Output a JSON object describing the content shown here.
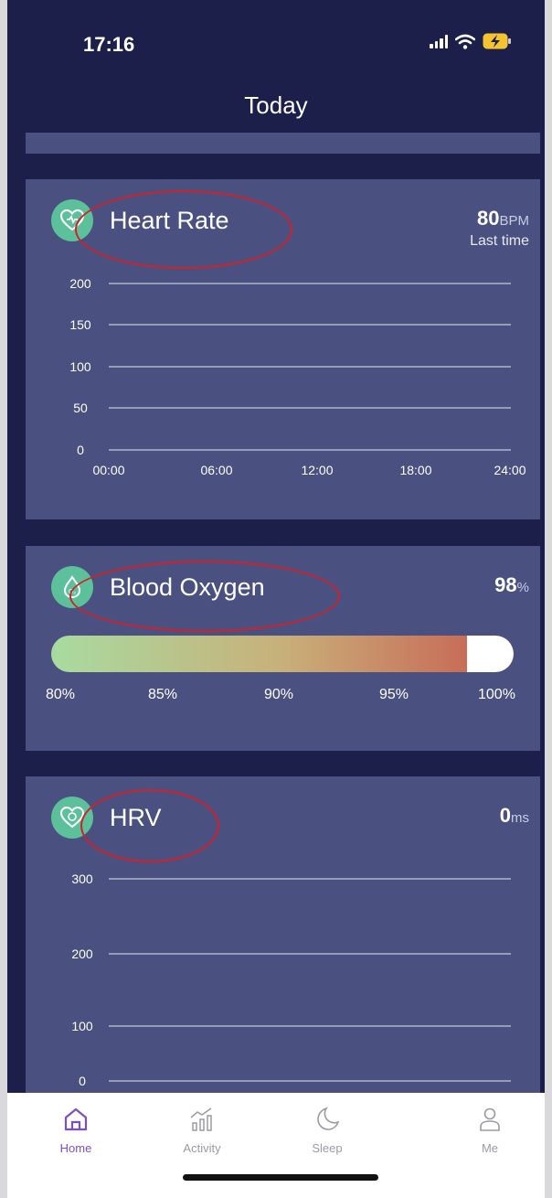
{
  "status": {
    "time": "17:16"
  },
  "header": {
    "title": "Today"
  },
  "heart_rate": {
    "title": "Heart Rate",
    "value": "80",
    "unit": "BPM",
    "sub": "Last time",
    "y_ticks": [
      "200",
      "150",
      "100",
      "50",
      "0"
    ],
    "x_ticks": [
      "00:00",
      "06:00",
      "12:00",
      "18:00",
      "24:00"
    ]
  },
  "blood_oxygen": {
    "title": "Blood Oxygen",
    "value": "98",
    "unit": "%",
    "level": 0.9,
    "scale": [
      "80%",
      "85%",
      "90%",
      "95%",
      "100%"
    ]
  },
  "hrv": {
    "title": "HRV",
    "value": "0",
    "unit": "ms",
    "y_ticks": [
      "300",
      "200",
      "100",
      "0"
    ]
  },
  "tabs": [
    {
      "label": "Home",
      "icon": "home-icon",
      "active": true
    },
    {
      "label": "Activity",
      "icon": "activity-icon",
      "active": false
    },
    {
      "label": "Sleep",
      "icon": "moon-icon",
      "active": false
    },
    {
      "label": "Me",
      "icon": "person-icon",
      "active": false
    }
  ],
  "colors": {
    "accent": "#7b4fc1",
    "card": "#4a5180",
    "background": "#1c1f4a",
    "icon_green": "#5cc19a",
    "annotation": "#d0202a"
  }
}
